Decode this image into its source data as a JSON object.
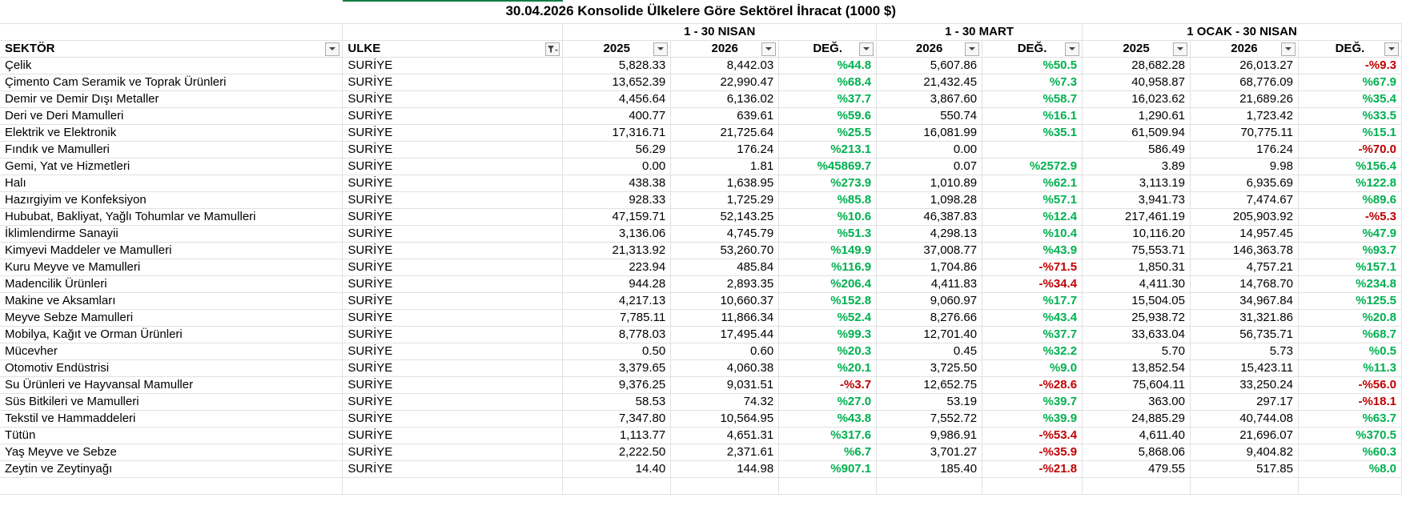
{
  "title": "30.04.2026 Konsolide Ülkelere Göre Sektörel İhracat  (1000 $)",
  "groups": {
    "nisan": "1 - 30 NISAN",
    "mart": "1 - 30 MART",
    "ocak": "1 OCAK  -  30 NISAN"
  },
  "headers": {
    "sektor": "SEKTÖR",
    "ulke": "ULKE",
    "n2025": "2025",
    "n2026": "2026",
    "ndeg": "DEĞ.",
    "m2026": "2026",
    "mdeg": "DEĞ.",
    "o2025": "2025",
    "o2026": "2026",
    "odeg": "DEĞ."
  },
  "icons": {
    "dropdown": "dropdown-arrow-icon",
    "filter_active": "filter-active-icon"
  },
  "colors": {
    "positive": "#00b050",
    "negative": "#c00000",
    "selection": "#107c41"
  },
  "rows": [
    {
      "sektor": "Çelik",
      "ulke": "SURİYE",
      "n2025": "5,828.33",
      "n2026": "8,442.03",
      "ndeg": "%44.8",
      "m2026": "5,607.86",
      "mdeg": "%50.5",
      "o2025": "28,682.28",
      "o2026": "26,013.27",
      "odeg": "-%9.3"
    },
    {
      "sektor": "Çimento Cam Seramik ve Toprak Ürünleri",
      "ulke": "SURİYE",
      "n2025": "13,652.39",
      "n2026": "22,990.47",
      "ndeg": "%68.4",
      "m2026": "21,432.45",
      "mdeg": "%7.3",
      "o2025": "40,958.87",
      "o2026": "68,776.09",
      "odeg": "%67.9"
    },
    {
      "sektor": "Demir ve Demir Dışı Metaller",
      "ulke": "SURİYE",
      "n2025": "4,456.64",
      "n2026": "6,136.02",
      "ndeg": "%37.7",
      "m2026": "3,867.60",
      "mdeg": "%58.7",
      "o2025": "16,023.62",
      "o2026": "21,689.26",
      "odeg": "%35.4"
    },
    {
      "sektor": "Deri ve Deri Mamulleri",
      "ulke": "SURİYE",
      "n2025": "400.77",
      "n2026": "639.61",
      "ndeg": "%59.6",
      "m2026": "550.74",
      "mdeg": "%16.1",
      "o2025": "1,290.61",
      "o2026": "1,723.42",
      "odeg": "%33.5"
    },
    {
      "sektor": "Elektrik ve Elektronik",
      "ulke": "SURİYE",
      "n2025": "17,316.71",
      "n2026": "21,725.64",
      "ndeg": "%25.5",
      "m2026": "16,081.99",
      "mdeg": "%35.1",
      "o2025": "61,509.94",
      "o2026": "70,775.11",
      "odeg": "%15.1"
    },
    {
      "sektor": "Fındık ve Mamulleri",
      "ulke": "SURİYE",
      "n2025": "56.29",
      "n2026": "176.24",
      "ndeg": "%213.1",
      "m2026": "0.00",
      "mdeg": "",
      "o2025": "586.49",
      "o2026": "176.24",
      "odeg": "-%70.0"
    },
    {
      "sektor": "Gemi, Yat ve Hizmetleri",
      "ulke": "SURİYE",
      "n2025": "0.00",
      "n2026": "1.81",
      "ndeg": "%45869.7",
      "m2026": "0.07",
      "mdeg": "%2572.9",
      "o2025": "3.89",
      "o2026": "9.98",
      "odeg": "%156.4"
    },
    {
      "sektor": "Halı",
      "ulke": "SURİYE",
      "n2025": "438.38",
      "n2026": "1,638.95",
      "ndeg": "%273.9",
      "m2026": "1,010.89",
      "mdeg": "%62.1",
      "o2025": "3,113.19",
      "o2026": "6,935.69",
      "odeg": "%122.8"
    },
    {
      "sektor": "Hazırgiyim ve Konfeksiyon",
      "ulke": "SURİYE",
      "n2025": "928.33",
      "n2026": "1,725.29",
      "ndeg": "%85.8",
      "m2026": "1,098.28",
      "mdeg": "%57.1",
      "o2025": "3,941.73",
      "o2026": "7,474.67",
      "odeg": "%89.6"
    },
    {
      "sektor": "Hububat, Bakliyat, Yağlı Tohumlar ve Mamulleri",
      "ulke": "SURİYE",
      "n2025": "47,159.71",
      "n2026": "52,143.25",
      "ndeg": "%10.6",
      "m2026": "46,387.83",
      "mdeg": "%12.4",
      "o2025": "217,461.19",
      "o2026": "205,903.92",
      "odeg": "-%5.3"
    },
    {
      "sektor": "İklimlendirme Sanayii",
      "ulke": "SURİYE",
      "n2025": "3,136.06",
      "n2026": "4,745.79",
      "ndeg": "%51.3",
      "m2026": "4,298.13",
      "mdeg": "%10.4",
      "o2025": "10,116.20",
      "o2026": "14,957.45",
      "odeg": "%47.9"
    },
    {
      "sektor": "Kimyevi Maddeler ve Mamulleri",
      "ulke": "SURİYE",
      "n2025": "21,313.92",
      "n2026": "53,260.70",
      "ndeg": "%149.9",
      "m2026": "37,008.77",
      "mdeg": "%43.9",
      "o2025": "75,553.71",
      "o2026": "146,363.78",
      "odeg": "%93.7"
    },
    {
      "sektor": "Kuru Meyve ve Mamulleri",
      "ulke": "SURİYE",
      "n2025": "223.94",
      "n2026": "485.84",
      "ndeg": "%116.9",
      "m2026": "1,704.86",
      "mdeg": "-%71.5",
      "o2025": "1,850.31",
      "o2026": "4,757.21",
      "odeg": "%157.1"
    },
    {
      "sektor": "Madencilik Ürünleri",
      "ulke": "SURİYE",
      "n2025": "944.28",
      "n2026": "2,893.35",
      "ndeg": "%206.4",
      "m2026": "4,411.83",
      "mdeg": "-%34.4",
      "o2025": "4,411.30",
      "o2026": "14,768.70",
      "odeg": "%234.8"
    },
    {
      "sektor": "Makine ve Aksamları",
      "ulke": "SURİYE",
      "n2025": "4,217.13",
      "n2026": "10,660.37",
      "ndeg": "%152.8",
      "m2026": "9,060.97",
      "mdeg": "%17.7",
      "o2025": "15,504.05",
      "o2026": "34,967.84",
      "odeg": "%125.5"
    },
    {
      "sektor": "Meyve Sebze Mamulleri",
      "ulke": "SURİYE",
      "n2025": "7,785.11",
      "n2026": "11,866.34",
      "ndeg": "%52.4",
      "m2026": "8,276.66",
      "mdeg": "%43.4",
      "o2025": "25,938.72",
      "o2026": "31,321.86",
      "odeg": "%20.8"
    },
    {
      "sektor": "Mobilya, Kağıt ve Orman Ürünleri",
      "ulke": "SURİYE",
      "n2025": "8,778.03",
      "n2026": "17,495.44",
      "ndeg": "%99.3",
      "m2026": "12,701.40",
      "mdeg": "%37.7",
      "o2025": "33,633.04",
      "o2026": "56,735.71",
      "odeg": "%68.7"
    },
    {
      "sektor": "Mücevher",
      "ulke": "SURİYE",
      "n2025": "0.50",
      "n2026": "0.60",
      "ndeg": "%20.3",
      "m2026": "0.45",
      "mdeg": "%32.2",
      "o2025": "5.70",
      "o2026": "5.73",
      "odeg": "%0.5"
    },
    {
      "sektor": "Otomotiv Endüstrisi",
      "ulke": "SURİYE",
      "n2025": "3,379.65",
      "n2026": "4,060.38",
      "ndeg": "%20.1",
      "m2026": "3,725.50",
      "mdeg": "%9.0",
      "o2025": "13,852.54",
      "o2026": "15,423.11",
      "odeg": "%11.3"
    },
    {
      "sektor": "Su Ürünleri ve Hayvansal Mamuller",
      "ulke": "SURİYE",
      "n2025": "9,376.25",
      "n2026": "9,031.51",
      "ndeg": "-%3.7",
      "m2026": "12,652.75",
      "mdeg": "-%28.6",
      "o2025": "75,604.11",
      "o2026": "33,250.24",
      "odeg": "-%56.0"
    },
    {
      "sektor": "Süs Bitkileri ve Mamulleri",
      "ulke": "SURİYE",
      "n2025": "58.53",
      "n2026": "74.32",
      "ndeg": "%27.0",
      "m2026": "53.19",
      "mdeg": "%39.7",
      "o2025": "363.00",
      "o2026": "297.17",
      "odeg": "-%18.1"
    },
    {
      "sektor": "Tekstil ve Hammaddeleri",
      "ulke": "SURİYE",
      "n2025": "7,347.80",
      "n2026": "10,564.95",
      "ndeg": "%43.8",
      "m2026": "7,552.72",
      "mdeg": "%39.9",
      "o2025": "24,885.29",
      "o2026": "40,744.08",
      "odeg": "%63.7"
    },
    {
      "sektor": "Tütün",
      "ulke": "SURİYE",
      "n2025": "1,113.77",
      "n2026": "4,651.31",
      "ndeg": "%317.6",
      "m2026": "9,986.91",
      "mdeg": "-%53.4",
      "o2025": "4,611.40",
      "o2026": "21,696.07",
      "odeg": "%370.5"
    },
    {
      "sektor": "Yaş Meyve ve Sebze",
      "ulke": "SURİYE",
      "n2025": "2,222.50",
      "n2026": "2,371.61",
      "ndeg": "%6.7",
      "m2026": "3,701.27",
      "mdeg": "-%35.9",
      "o2025": "5,868.06",
      "o2026": "9,404.82",
      "odeg": "%60.3"
    },
    {
      "sektor": "Zeytin ve Zeytinyağı",
      "ulke": "SURİYE",
      "n2025": "14.40",
      "n2026": "144.98",
      "ndeg": "%907.1",
      "m2026": "185.40",
      "mdeg": "-%21.8",
      "o2025": "479.55",
      "o2026": "517.85",
      "odeg": "%8.0"
    }
  ]
}
